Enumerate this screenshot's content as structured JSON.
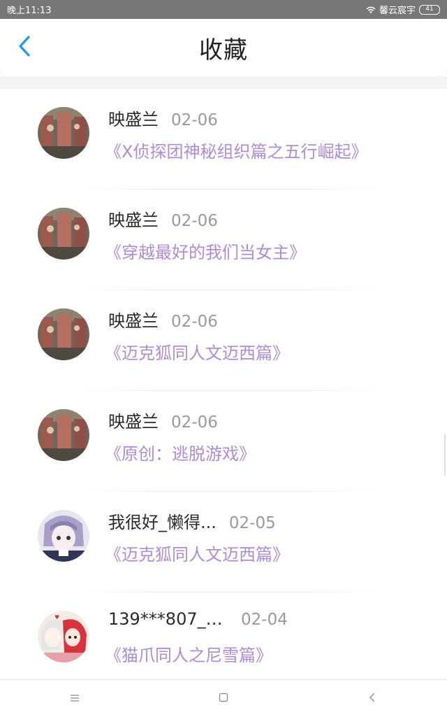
{
  "status_bar": {
    "time": "晚上11:13",
    "carrier": "馨云宸宇",
    "battery": "41",
    "wifi_icon": "wifi-icon"
  },
  "header": {
    "title": "收藏",
    "back_icon": "chevron-left-icon",
    "accent_color": "#2196f3"
  },
  "items": [
    {
      "name": "映盛兰",
      "date": "02-06",
      "title": "《X侦探团神秘组织篇之五行崛起》",
      "avatar": "avatar-theater"
    },
    {
      "name": "映盛兰",
      "date": "02-06",
      "title": "《穿越最好的我们当女主》",
      "avatar": "avatar-theater"
    },
    {
      "name": "映盛兰",
      "date": "02-06",
      "title": "《迈克狐同人文迈西篇》",
      "avatar": "avatar-theater"
    },
    {
      "name": "映盛兰",
      "date": "02-06",
      "title": "《原创：逃脱游戏》",
      "avatar": "avatar-theater"
    },
    {
      "name": "我很好_懒得...",
      "date": "02-05",
      "title": "《迈克狐同人文迈西篇》",
      "avatar": "avatar-anime-purple"
    },
    {
      "name": "139***807_6...",
      "date": "02-04",
      "title": "《猫爪同人之尼雪篇》",
      "avatar": "avatar-anime-red"
    }
  ],
  "colors": {
    "title_purple": "#b18ad6",
    "date_gray": "#9a9a9a",
    "status_bar": "#777777"
  },
  "nav_bar": {
    "menu_icon": "menu-icon",
    "home_icon": "square-home-icon",
    "back_icon": "triangle-back-icon"
  }
}
